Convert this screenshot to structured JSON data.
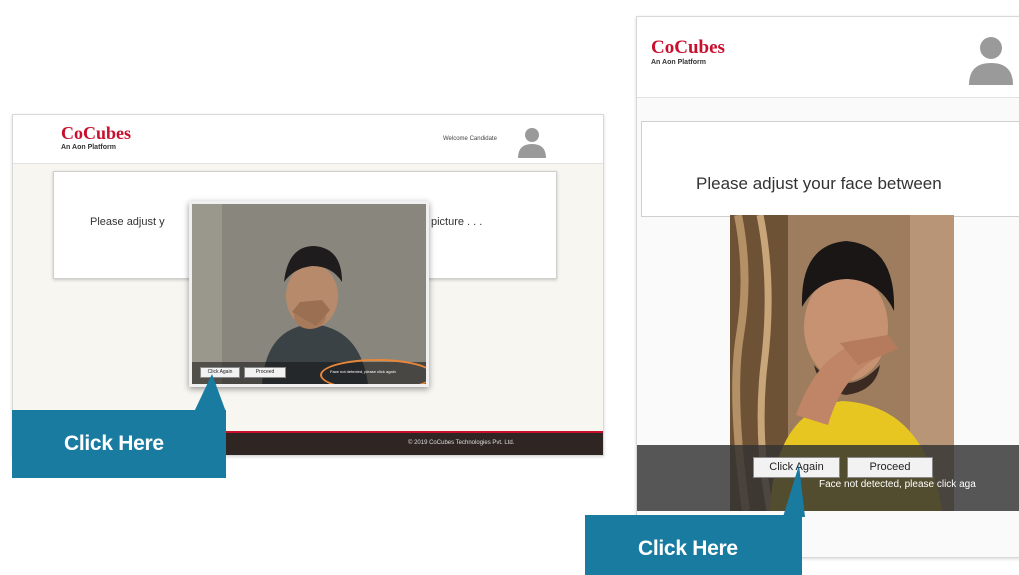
{
  "left_screenshot": {
    "logo": "CoCubes",
    "logo_subtitle": "An Aon Platform",
    "welcome_text": "Welcome Candidate",
    "message_part1": "Please adjust y",
    "message_part2": "ber picture . . .",
    "webcam": {
      "click_again_label": "Click Again",
      "proceed_label": "Proceed",
      "status_text": "Face not detected, please click again"
    },
    "footer_text": "© 2019 CoCubes Technologies Pvt. Ltd."
  },
  "right_screenshot": {
    "logo": "CoCubes",
    "logo_subtitle": "An Aon Platform",
    "message": "Please adjust your face between",
    "webcam": {
      "click_again_label": "Click Again",
      "proceed_label": "Proceed",
      "status_text": "Face not detected, please click aga"
    }
  },
  "callouts": {
    "left_label": "Click Here",
    "right_label": "Click Here"
  },
  "colors": {
    "brand_red": "#c8102e",
    "callout_blue": "#1a7ba1",
    "highlight_orange": "#e8873a",
    "footer_dark": "#2f2623"
  }
}
